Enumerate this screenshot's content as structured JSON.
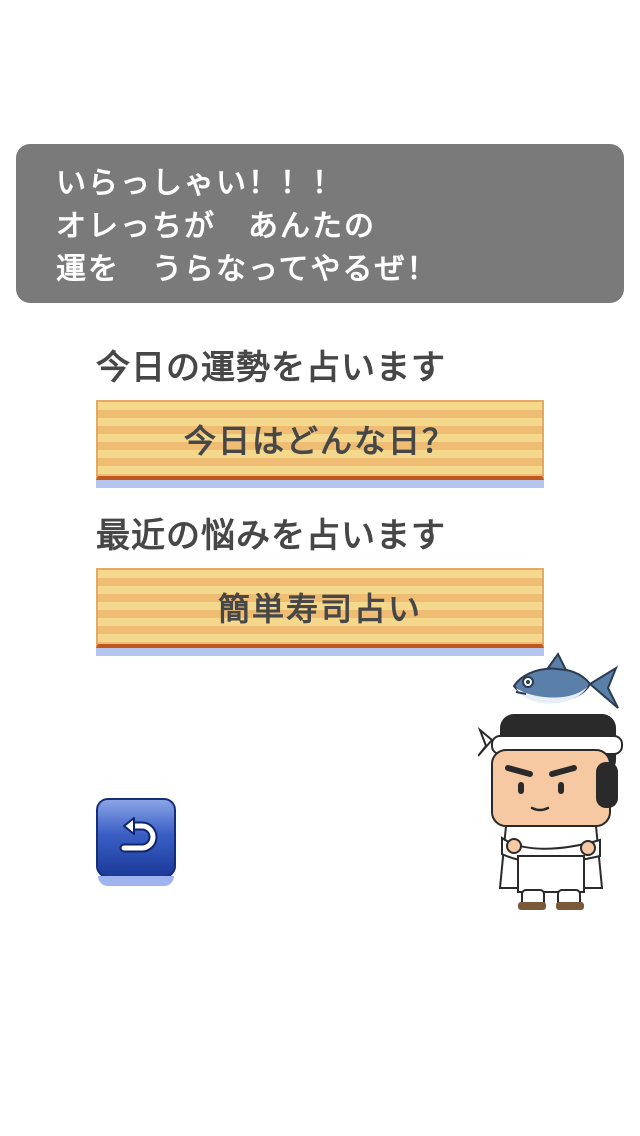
{
  "speech": {
    "lines": [
      "いらっしゃい！！！",
      "オレっちが　あんたの",
      "運を　うらなってやるぜ！"
    ]
  },
  "sections": [
    {
      "label": "今日の運勢を占います",
      "button_label": "今日はどんな日？"
    },
    {
      "label": "最近の悩みを占います",
      "button_label": "簡単寿司占い"
    }
  ],
  "colors": {
    "speech_bg": "#7a7a7a",
    "stripe_light": "#f4d98d",
    "stripe_dark": "#eebc73",
    "button_shadow": "#b5c5ee",
    "back_button_blue": "#2a4fb8",
    "text": "#474747"
  },
  "icons": {
    "back": "return-arrow-icon",
    "mascot": "sushi-chef-with-tuna-icon"
  }
}
